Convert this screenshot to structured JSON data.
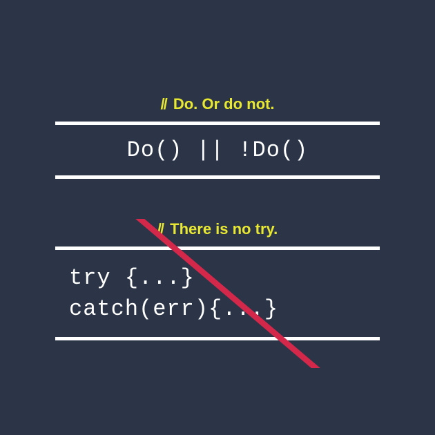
{
  "section1": {
    "comment": "Do. Or do not.",
    "code": "Do() || !Do()"
  },
  "section2": {
    "comment": "There is no try.",
    "code_line1": "try {...}",
    "code_line2": "catch(err){...}"
  }
}
